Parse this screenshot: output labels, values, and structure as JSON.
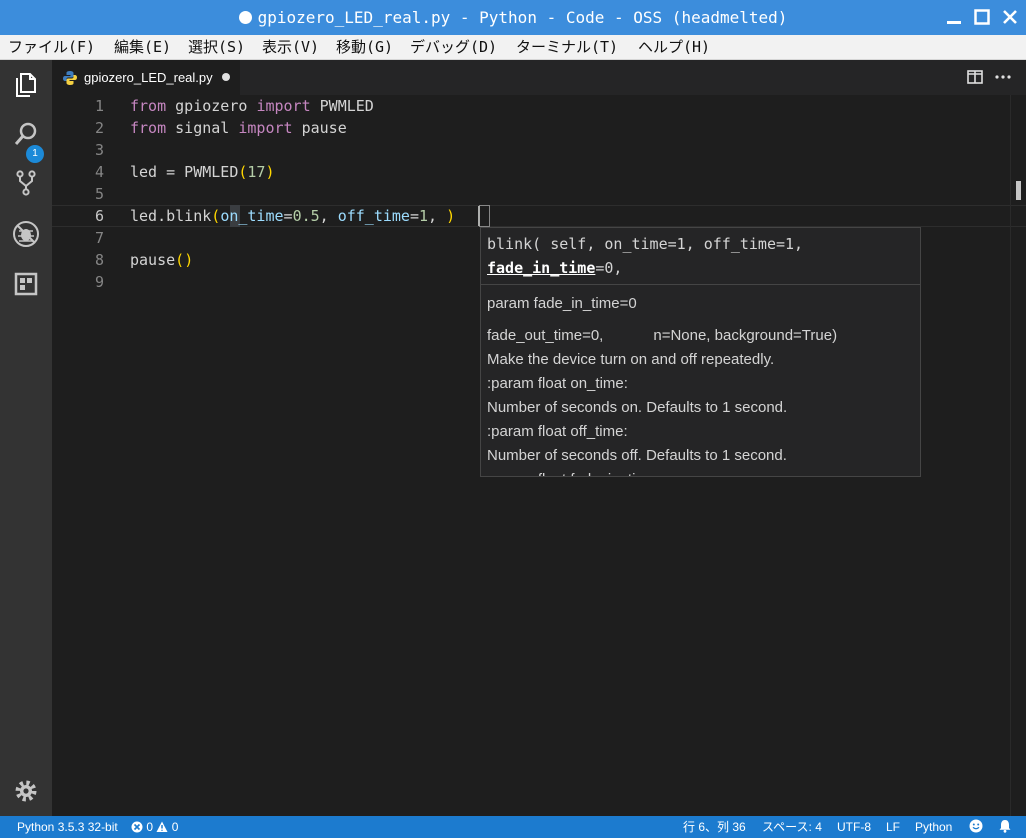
{
  "window": {
    "title": "gpiozero_LED_real.py - Python - Code - OSS (headmelted)"
  },
  "menu": [
    "ファイル(F)",
    "編集(E)",
    "選択(S)",
    "表示(V)",
    "移動(G)",
    "デバッグ(D)",
    "ターミナル(T)",
    "ヘルプ(H)"
  ],
  "activity": {
    "explorer_badge": "1"
  },
  "tab": {
    "label": "gpiozero_LED_real.py"
  },
  "editor": {
    "line_numbers": [
      "1",
      "2",
      "3",
      "4",
      "5",
      "6",
      "7",
      "8",
      "9"
    ],
    "lines": [
      {
        "kw1": "from",
        "mod": " gpiozero ",
        "kw2": "import",
        "name": " PWMLED"
      },
      {
        "kw1": "from",
        "mod": " signal ",
        "kw2": "import",
        "name": " pause"
      },
      {},
      {
        "pre": "led = PWMLED",
        "open": "(",
        "num": "17",
        "close": ")"
      },
      {},
      {
        "pre": "led.blink",
        "open": "(",
        "p1": "on_time",
        "eq1": "=",
        "v1": "0.5",
        ", ": ", ",
        "p2": "off_time",
        "eq2": "=",
        "v2": "1",
        "tail": ", ",
        "close": ")"
      },
      {},
      {
        "pre": "pause",
        "open": "(",
        "close": ")"
      },
      {}
    ]
  },
  "hover": {
    "sig_line1": "blink( self, on_time=1, off_time=1,",
    "sig_active": "fade_in_time",
    "sig_rest": "=0,",
    "doc": [
      "param fade_in_time=0",
      "fade_out_time=0,            n=None, background=True)",
      "Make the device turn on and off repeatedly.",
      ":param float on_time:",
      "Number of seconds on. Defaults to 1 second.",
      ":param float off_time:",
      "Number of seconds off. Defaults to 1 second.",
      ":param float fade_in_time:"
    ]
  },
  "status": {
    "interpreter": "Python 3.5.3 32-bit",
    "errors": "0",
    "warnings": "0",
    "position": "行 6、列 36",
    "spaces": "スペース: 4",
    "encoding": "UTF-8",
    "eol": "LF",
    "language": "Python"
  },
  "colors": {
    "titlebar": "#3c8ddc",
    "statusbar": "#1c7bcf",
    "editor_bg": "#1e1e1e",
    "keyword": "#c586c0",
    "number": "#b5cea8",
    "parameter": "#9cdcfe",
    "bracket": "#ffd700"
  },
  "icons": [
    "explorer-icon",
    "search-icon",
    "source-control-icon",
    "debug-icon",
    "extensions-icon",
    "settings-gear-icon",
    "python-file-icon",
    "split-editor-icon",
    "more-actions-icon",
    "minimize-icon",
    "maximize-icon",
    "close-icon",
    "error-icon",
    "warning-icon",
    "smiley-icon",
    "bell-icon"
  ]
}
